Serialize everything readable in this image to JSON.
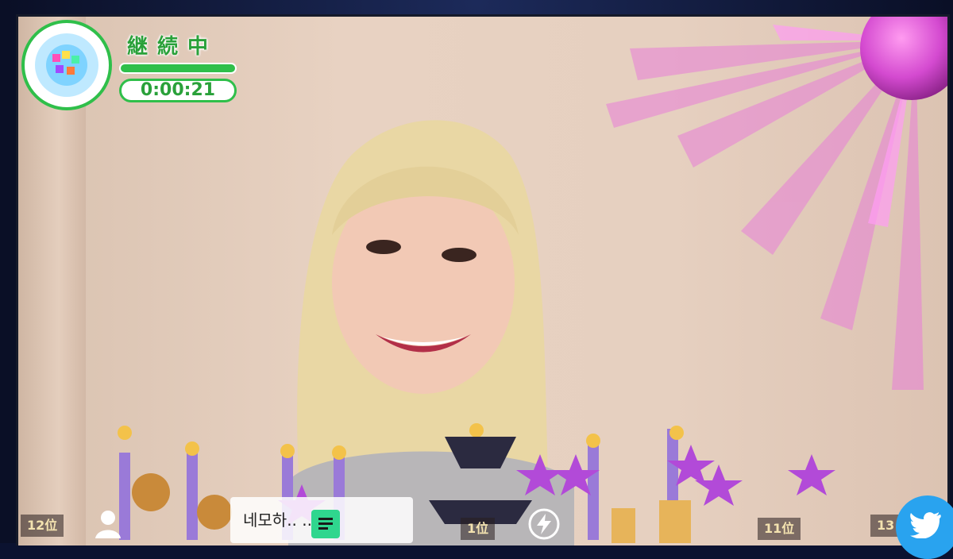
{
  "stream": {
    "status_label": "継続中",
    "elapsed_time": "0:00:21",
    "progress_fraction": 1.0
  },
  "ranks": [
    {
      "label": "12位"
    },
    {
      "label": "1位"
    },
    {
      "label": "11位"
    },
    {
      "label": "13"
    }
  ],
  "comment": {
    "text": "네모하..  ..!"
  },
  "icons": {
    "profile": "profile-icon",
    "comments": "comment-list-icon",
    "boost": "lightning-icon",
    "share": "twitter-icon",
    "badge": "disco-ball-icon"
  },
  "colors": {
    "accent_green": "#2fbf4a",
    "twitter_blue": "#29a3ef",
    "ray_pink": "#e04bd8"
  }
}
